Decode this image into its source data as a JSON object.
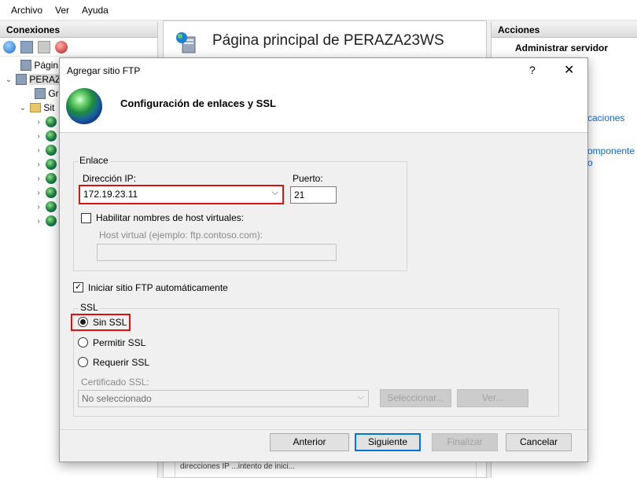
{
  "menu": [
    "Archivo",
    "Ver",
    "Ayuda"
  ],
  "connections": {
    "title": "Conexiones",
    "tree": {
      "root_start": "Págin",
      "server": "PERAZ",
      "child1": "Gr",
      "child2": "Sit"
    }
  },
  "home": {
    "title": "Página principal de PERAZA23WS",
    "bottom_text": "direcciones IP ...intento de inici..."
  },
  "actions": {
    "title": "Acciones",
    "heading": "Administrar servidor",
    "link1": "caciones",
    "link2a": "omponente",
    "link2b": "o"
  },
  "dialog": {
    "title": "Agregar sitio FTP",
    "help": "?",
    "close": "✕",
    "heading": "Configuración de enlaces y SSL",
    "binding": {
      "legend": "Enlace",
      "ip_label": "Dirección IP:",
      "ip_value": "172.19.23.11",
      "port_label": "Puerto:",
      "port_value": "21",
      "virtual_host_check": "Habilitar nombres de host virtuales:",
      "virtual_host_checked": false,
      "virtual_host_label": "Host virtual (ejemplo: ftp.contoso.com):",
      "virtual_host_value": ""
    },
    "autostart_label": "Iniciar sitio FTP automáticamente",
    "autostart_checked": true,
    "ssl": {
      "legend": "SSL",
      "options": [
        "Sin SSL",
        "Permitir SSL",
        "Requerir SSL"
      ],
      "selected": "Sin SSL",
      "cert_label": "Certificado SSL:",
      "cert_value": "No seleccionado",
      "select_button": "Seleccionar...",
      "view_button": "Ver..."
    },
    "buttons": {
      "back": "Anterior",
      "next": "Siguiente",
      "finish": "Finalizar",
      "cancel": "Cancelar"
    }
  },
  "colors": {
    "highlight": "#e01010",
    "default_button_border": "#0078d7",
    "link": "#1565c0"
  }
}
